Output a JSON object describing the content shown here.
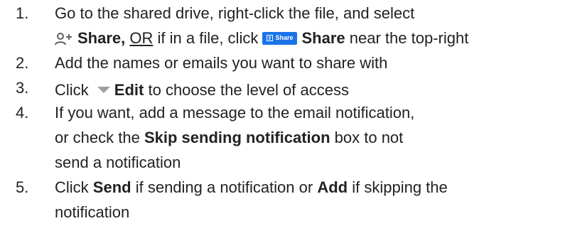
{
  "steps": [
    {
      "number": "1.",
      "line1": "Go to the shared drive, right-click the file, and select",
      "line2_share": "Share,",
      "line2_or": "OR",
      "line2_mid": "if in a file, click",
      "share_button_label": "Share",
      "line2_share_bold": "Share",
      "line2_end": "near the top-right"
    },
    {
      "number": "2.",
      "text": "Add the names or emails you want to share with"
    },
    {
      "number": "3.",
      "prefix": "Click",
      "bold": "Edit",
      "suffix": "to choose the level of access"
    },
    {
      "number": "4.",
      "line1": "If you want, add a message to the email notification,",
      "line2_prefix": "or check the",
      "line2_bold": "Skip sending notification",
      "line2_suffix": "box to not",
      "line3": "send a notification"
    },
    {
      "number": "5.",
      "prefix": "Click",
      "bold1": "Send",
      "middle": "if sending a notification or",
      "bold2": "Add",
      "suffix": "if skipping the",
      "line2": "notification"
    }
  ],
  "colors": {
    "text": "#222222",
    "share_button": "#1a73e8",
    "icon_gray": "#5f6368"
  },
  "icons": [
    "person-add-icon",
    "share-doc-icon",
    "dropdown-caret-icon"
  ]
}
